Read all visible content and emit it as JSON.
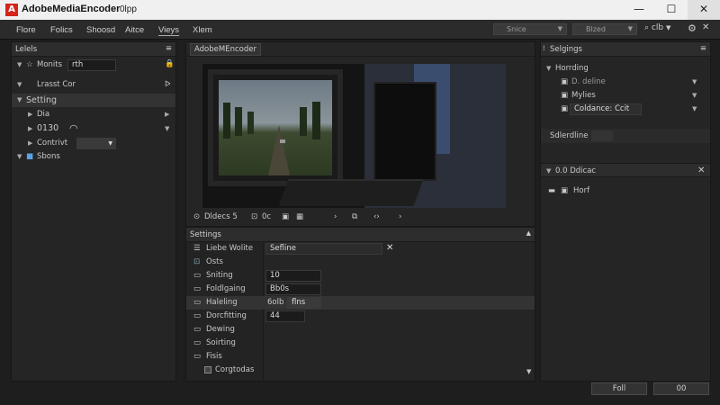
{
  "titlebar": {
    "logo": "A",
    "title": "AdobeMediaEncoder",
    "title_suffix": "0lpp",
    "minimize_icon": "minimize-icon",
    "maximize_icon": "maximize-icon",
    "close_icon": "close-icon"
  },
  "menu": {
    "items": [
      "Flore",
      "Folics",
      "Shoosd",
      "Aitce",
      "Vieys",
      "Xlem"
    ],
    "right_dropdowns": [
      "Snice",
      "Blzed"
    ],
    "zoom_label": "clb",
    "settings_icon": "gear-icon"
  },
  "left_panel": {
    "title": "Lelels",
    "rows": [
      {
        "label": "Monits",
        "value": "rth"
      },
      {
        "label": "Lrasst Cor"
      },
      {
        "label": "Setting"
      },
      {
        "label": "Dia"
      },
      {
        "label": "0130"
      },
      {
        "label": "Contrivt"
      },
      {
        "label": "Sbons"
      }
    ]
  },
  "preview_panel": {
    "tab": "AdobeMEncoder",
    "controls_label": "Dldecs 5",
    "timecode": "0c"
  },
  "settings_panel": {
    "title": "Settings",
    "rows": [
      {
        "label": "Liebe Wolite",
        "value": "Sefline"
      },
      {
        "label": "Osts"
      },
      {
        "label": "Sniting",
        "value": "10"
      },
      {
        "label": "Foldlgaing",
        "value": "Bb0s"
      },
      {
        "label": "Haleling",
        "value": "6olb",
        "extra": "flns"
      },
      {
        "label": "Dorcfitting",
        "value": "44"
      },
      {
        "label": "Dewing"
      },
      {
        "label": "Soirting"
      },
      {
        "label": "Fisis"
      }
    ],
    "checkbox_label": "Corgtodas"
  },
  "right_panel": {
    "title": "Selgings",
    "section": "Horrding",
    "items": [
      "D. deline",
      "Mylies",
      "Coldance: Ccit"
    ],
    "section2": "Sdlerdline",
    "section3": "0.0 Ddicac",
    "item4": "Horf"
  },
  "footer": {
    "ok_label": "Foll",
    "cancel_label": "00"
  }
}
